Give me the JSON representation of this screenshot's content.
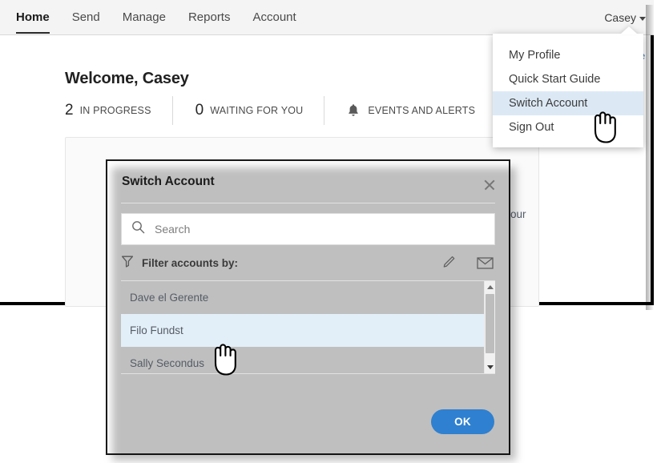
{
  "topnav": {
    "items": [
      {
        "label": "Home",
        "active": true
      },
      {
        "label": "Send",
        "active": false
      },
      {
        "label": "Manage",
        "active": false
      },
      {
        "label": "Reports",
        "active": false
      },
      {
        "label": "Account",
        "active": false
      }
    ],
    "user_label": "Casey"
  },
  "page": {
    "welcome_title": "Welcome, Casey",
    "stats": [
      {
        "number": "2",
        "label": "IN PROGRESS",
        "icon": ""
      },
      {
        "number": "0",
        "label": "WAITING FOR YOU",
        "icon": ""
      },
      {
        "number": "",
        "label": "EVENTS AND ALERTS",
        "icon": "bell-icon"
      }
    ],
    "link_fragment": "e",
    "card_text_fragment": "our"
  },
  "user_dropdown": {
    "items": [
      {
        "label": "My Profile",
        "highlight": false
      },
      {
        "label": "Quick Start Guide",
        "highlight": false
      },
      {
        "label": "Switch Account",
        "highlight": true
      },
      {
        "label": "Sign Out",
        "highlight": false
      }
    ]
  },
  "modal": {
    "title": "Switch Account",
    "close_icon": "close-icon",
    "search": {
      "placeholder": "Search",
      "value": "",
      "icon": "search-icon"
    },
    "filter": {
      "label": "Filter accounts by:",
      "icon": "filter-funnel-icon",
      "actions": [
        {
          "icon": "pencil-edit-icon",
          "name": "filter-by-name"
        },
        {
          "icon": "envelope-mail-icon",
          "name": "filter-by-email"
        }
      ]
    },
    "accounts": [
      {
        "name": "Dave el Gerente",
        "selected": false
      },
      {
        "name": "Filo Fundst",
        "selected": true
      },
      {
        "name": "Sally Secondus",
        "selected": false
      }
    ],
    "scrollbar": {
      "up_icon": "scroll-up-arrow-icon",
      "down_icon": "scroll-down-arrow-icon"
    },
    "ok_label": "OK"
  },
  "colors": {
    "accent_blue": "#2f80d0",
    "highlight_blue": "#dce9f5",
    "row_selected": "#e3eff8",
    "nav_bg": "#f4f4f4",
    "link": "#2f6ca8"
  }
}
